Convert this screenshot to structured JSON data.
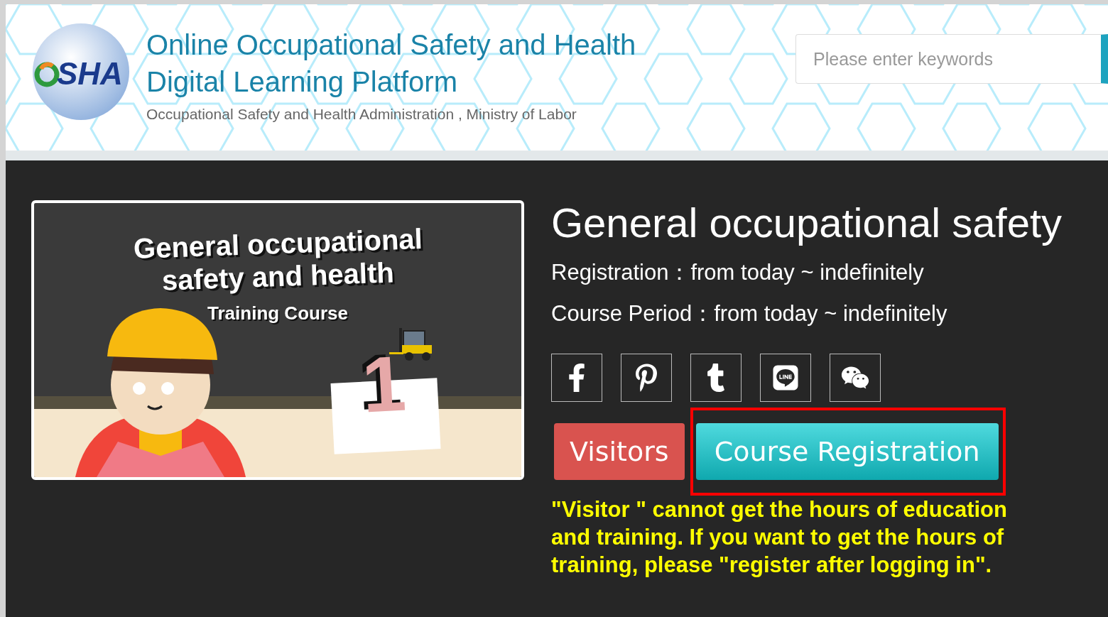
{
  "header": {
    "logo": "SHA",
    "title_lines": [
      "Online Occupational Safety and Health",
      "Digital Learning Platform"
    ],
    "subtitle": "Occupational Safety and Health Administration , Ministry of Labor",
    "search": {
      "placeholder": "Please enter keywords"
    }
  },
  "course": {
    "thumbnail": {
      "title_lines": [
        "General occupational",
        "safety and health"
      ],
      "subtitle": "Training Course",
      "number": "1"
    },
    "title": "General occupational safety",
    "info": [
      "Registration：from today ~ indefinitely",
      "Course Period：from today ~ indefinitely"
    ],
    "share": [
      {
        "kind": "facebook"
      },
      {
        "kind": "pinterest"
      },
      {
        "kind": "tumblr"
      },
      {
        "kind": "line"
      },
      {
        "kind": "wechat"
      }
    ],
    "buttons": [
      {
        "label": "Visitors",
        "kind": "visitor",
        "highlighted": false
      },
      {
        "label": "Course Registration",
        "kind": "register",
        "highlighted": true
      }
    ],
    "notice": "\"Visitor \" cannot get the hours of education and training. If you want to get the hours of training, please \"register after logging in\"."
  }
}
